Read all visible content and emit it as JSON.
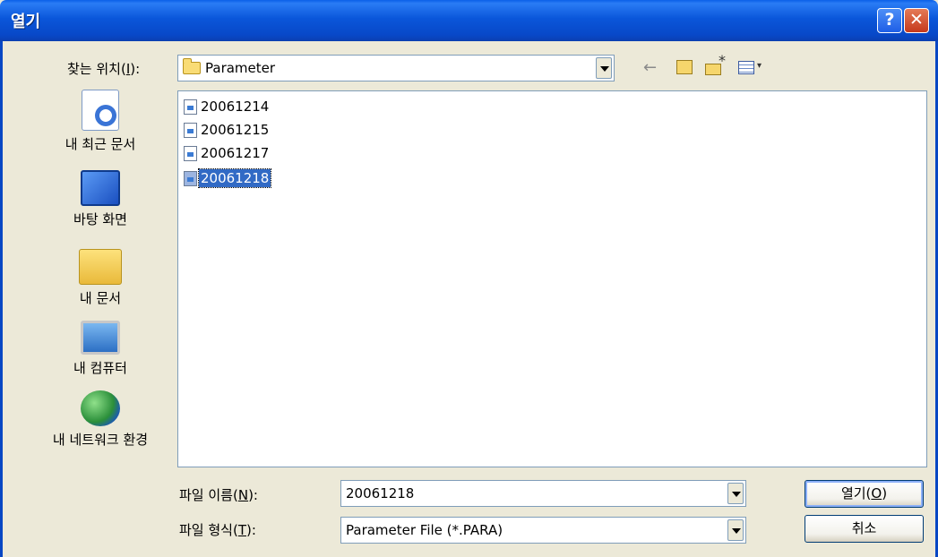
{
  "window": {
    "title": "열기",
    "help_label": "?",
    "close_label": "✕"
  },
  "lookin": {
    "label_pre": "찾는 위치(",
    "label_key": "I",
    "label_post": "):",
    "value": "Parameter"
  },
  "toolbar": {
    "back_glyph": "←",
    "up_glyph": "⮤",
    "view_arrow": "▾"
  },
  "places": [
    {
      "label": "내 최근 문서",
      "icon": "recent-documents-icon"
    },
    {
      "label": "바탕 화면",
      "icon": "desktop-icon"
    },
    {
      "label": "내 문서",
      "icon": "my-documents-icon"
    },
    {
      "label": "내 컴퓨터",
      "icon": "my-computer-icon"
    },
    {
      "label": "내 네트워크 환경",
      "icon": "network-icon"
    }
  ],
  "files": [
    {
      "name": "20061214",
      "selected": false
    },
    {
      "name": "20061215",
      "selected": false
    },
    {
      "name": "20061217",
      "selected": false
    },
    {
      "name": "20061218",
      "selected": true
    }
  ],
  "filename": {
    "label_pre": "파일 이름(",
    "label_key": "N",
    "label_post": "):",
    "value": "20061218"
  },
  "filetype": {
    "label_pre": "파일 형식(",
    "label_key": "T",
    "label_post": "):",
    "value": "Parameter File (*.PARA)"
  },
  "buttons": {
    "open_pre": "열기(",
    "open_key": "O",
    "open_post": ")",
    "cancel": "취소"
  }
}
